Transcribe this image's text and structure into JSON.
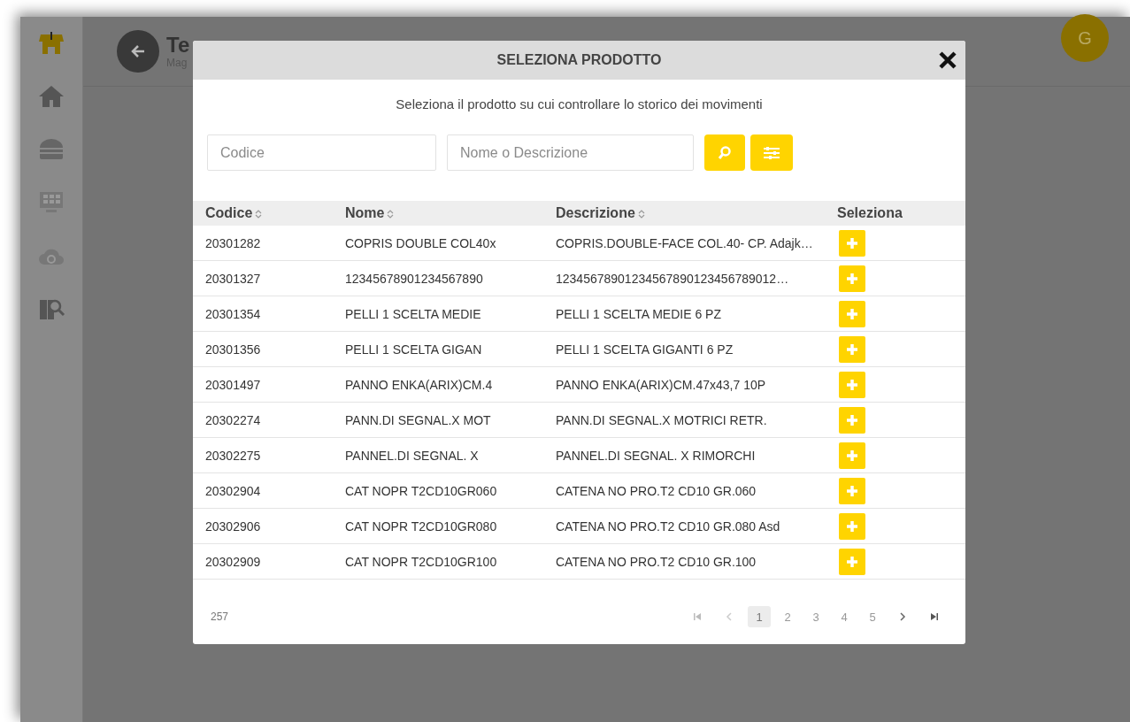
{
  "header": {
    "title": "Te",
    "subtitle": "Mag",
    "avatar": "G"
  },
  "sidebar": {
    "items": [
      {
        "kind": "home",
        "selected": false
      },
      {
        "kind": "burger",
        "selected": false
      },
      {
        "kind": "register",
        "selected": false
      },
      {
        "kind": "cloud",
        "selected": false
      },
      {
        "kind": "search",
        "selected": false
      }
    ]
  },
  "modal": {
    "title": "SELEZIONA PRODOTTO",
    "subtitle": "Seleziona il prodotto su cui controllare lo storico dei movimenti",
    "fields": [
      {
        "placeholder": "Codice"
      },
      {
        "placeholder": "Nome o Descrizione"
      }
    ],
    "table": {
      "columns": [
        {
          "label": "Codice",
          "sortable": true
        },
        {
          "label": "Nome",
          "sortable": true
        },
        {
          "label": "Descrizione",
          "sortable": true
        },
        {
          "label": "Seleziona",
          "sortable": false
        }
      ],
      "rows": [
        {
          "codice": "20301282",
          "nome": "COPRIS DOUBLE COL40x",
          "descrizione": "COPRIS.DOUBLE-FACE COL.40- CP. Adajk…"
        },
        {
          "codice": "20301327",
          "nome": "12345678901234567890",
          "descrizione": "12345678901234567890123456789012…"
        },
        {
          "codice": "20301354",
          "nome": "PELLI 1 SCELTA MEDIE",
          "descrizione": "PELLI 1 SCELTA MEDIE 6 PZ"
        },
        {
          "codice": "20301356",
          "nome": "PELLI 1 SCELTA GIGAN",
          "descrizione": "PELLI 1 SCELTA GIGANTI 6 PZ"
        },
        {
          "codice": "20301497",
          "nome": "PANNO ENKA(ARIX)CM.4",
          "descrizione": "PANNO ENKA(ARIX)CM.47x43,7 10P"
        },
        {
          "codice": "20302274",
          "nome": "PANN.DI SEGNAL.X MOT",
          "descrizione": "PANN.DI SEGNAL.X MOTRICI RETR."
        },
        {
          "codice": "20302275",
          "nome": "PANNEL.DI SEGNAL. X",
          "descrizione": "PANNEL.DI SEGNAL. X RIMORCHI"
        },
        {
          "codice": "20302904",
          "nome": "CAT NOPR T2CD10GR060",
          "descrizione": "CATENA NO PRO.T2 CD10 GR.060"
        },
        {
          "codice": "20302906",
          "nome": "CAT NOPR T2CD10GR080",
          "descrizione": "CATENA NO PRO.T2 CD10 GR.080 Asd"
        },
        {
          "codice": "20302909",
          "nome": "CAT NOPR T2CD10GR100",
          "descrizione": "CATENA NO PRO.T2 CD10 GR.100"
        }
      ]
    },
    "footer": {
      "total": "257",
      "pages": [
        {
          "label": "1",
          "selected": true
        },
        {
          "label": "2",
          "selected": false
        },
        {
          "label": "3",
          "selected": false
        },
        {
          "label": "4",
          "selected": false
        },
        {
          "label": "5",
          "selected": false
        }
      ]
    }
  }
}
